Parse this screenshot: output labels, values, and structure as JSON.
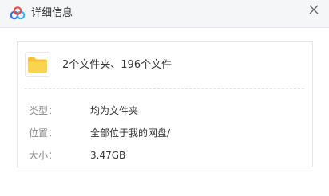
{
  "window": {
    "title": "详细信息",
    "app_icon": "cloud-logo-icon",
    "close_icon": "close-icon"
  },
  "summary": {
    "icon": "folder-icon",
    "text": "2个文件夹、196个文件"
  },
  "details": [
    {
      "label": "类型：",
      "value": "均为文件夹"
    },
    {
      "label": "位置：",
      "value": "全部位于我的网盘/"
    },
    {
      "label": "大小：",
      "value": "3.47GB"
    }
  ],
  "colors": {
    "folder": "#f9c932",
    "accent_blue": "#2f7bff",
    "title_bar": "#f5f6f8"
  }
}
